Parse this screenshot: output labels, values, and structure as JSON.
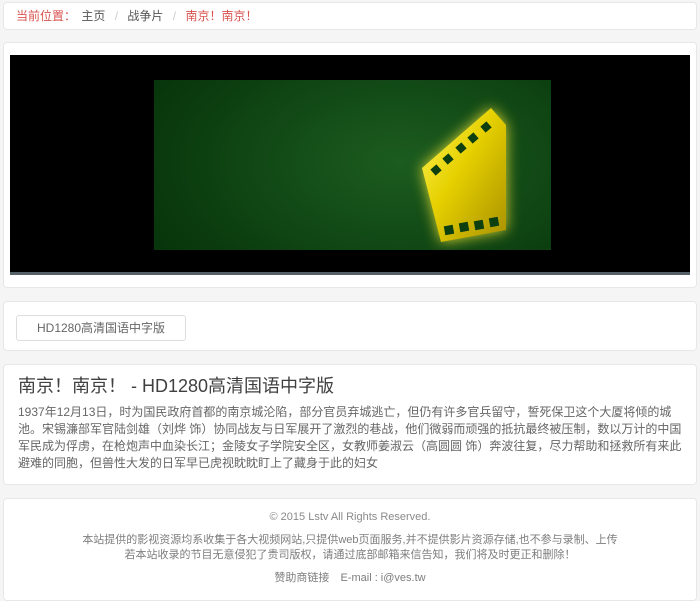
{
  "colors": {
    "accent": "#d9534f",
    "film-yellow": "#f0dc00",
    "screen-green": "#124a16",
    "player-black": "#000000"
  },
  "breadcrumb": {
    "label": "当前位置：",
    "separator": "/",
    "items": [
      {
        "label": "主页"
      },
      {
        "label": "战争片"
      }
    ],
    "current": "南京！南京！"
  },
  "player": {
    "film_strip_icon": "film-strip-icon"
  },
  "episodes": {
    "button_label": "HD1280高清国语中字版"
  },
  "info": {
    "title": "南京！南京！ - HD1280高清国语中字版",
    "description": "1937年12月13日，时为国民政府首都的南京城沦陷，部分官员弃城逃亡，但仍有许多官兵留守，誓死保卫这个大厦将倾的城池。宋锡濂部军官陆剑雄（刘烨 饰）协同战友与日军展开了激烈的巷战，他们微弱而顽强的抵抗最终被压制，数以万计的中国军民成为俘虏，在枪炮声中血染长江；金陵女子学院安全区，女教师姜淑云（高圆圆 饰）奔波往复，尽力帮助和拯救所有来此避难的同胞，但兽性大发的日军早已虎视眈眈盯上了藏身于此的妇女"
  },
  "footer": {
    "copyright": "© 2015 Lstv All Rights Reserved.",
    "disclaimer1": "本站提供的影视资源均系收集于各大视频网站,只提供web页面服务,并不提供影片资源存储,也不参与录制、上传",
    "disclaimer2": "若本站收录的节目无意侵犯了贵司版权，请通过底部邮箱来信告知，我们将及时更正和删除！",
    "sponsor_label": "赞助商链接",
    "email": "E-mail : i@ves.tw"
  }
}
